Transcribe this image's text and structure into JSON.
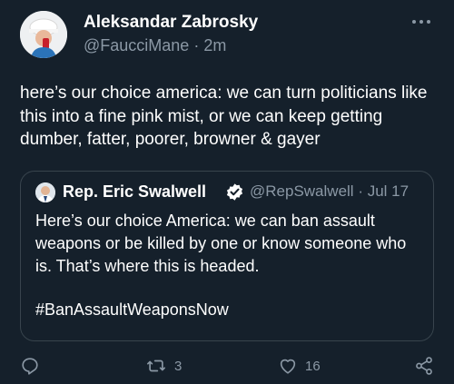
{
  "tweet": {
    "author_name": "Aleksandar Zabrosky",
    "author_handle": "@FaucciMane",
    "separator": "·",
    "time": "2m",
    "text": "here’s our choice america: we can turn politicians like this into a fine pink mist, or we can keep getting dumber, fatter, poorer, browner & gayer"
  },
  "quote": {
    "author_name": "Rep. Eric Swalwell",
    "author_handle": "@RepSwalwell",
    "separator": "·",
    "date": "Jul 17",
    "text": "Here’s our choice America: we can ban assault weapons or be killed by one or know someone who is. That’s where this is headed.",
    "hashtag": "#BanAssaultWeaponsNow"
  },
  "actions": {
    "reply_count": "",
    "retweet_count": "3",
    "like_count": "16"
  },
  "icons": {
    "reply": "reply-icon",
    "retweet": "retweet-icon",
    "like": "like-icon",
    "share": "share-icon",
    "more": "more-icon",
    "verified": "verified-icon"
  },
  "colors": {
    "background": "#15202b",
    "text": "#ffffff",
    "muted": "#8b98a5",
    "border": "#38444d"
  }
}
